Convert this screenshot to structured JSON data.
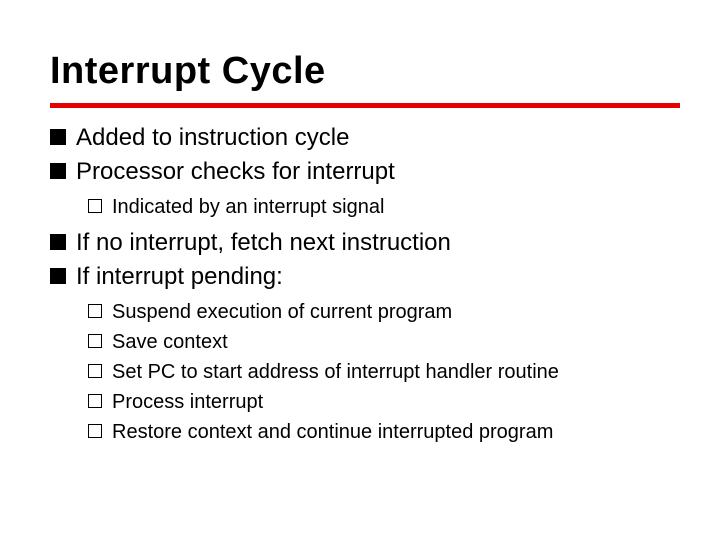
{
  "title": "Interrupt Cycle",
  "bullets": [
    {
      "text": "Added to instruction cycle"
    },
    {
      "text": "Processor checks for interrupt",
      "children": [
        {
          "text": "Indicated by an interrupt signal"
        }
      ]
    },
    {
      "text": "If no interrupt, fetch next instruction"
    },
    {
      "text": "If interrupt pending:",
      "children": [
        {
          "text": "Suspend execution of current program"
        },
        {
          "text": "Save context"
        },
        {
          "text": "Set PC to start address of interrupt handler routine"
        },
        {
          "text": "Process interrupt"
        },
        {
          "text": "Restore context and continue interrupted program"
        }
      ]
    }
  ]
}
